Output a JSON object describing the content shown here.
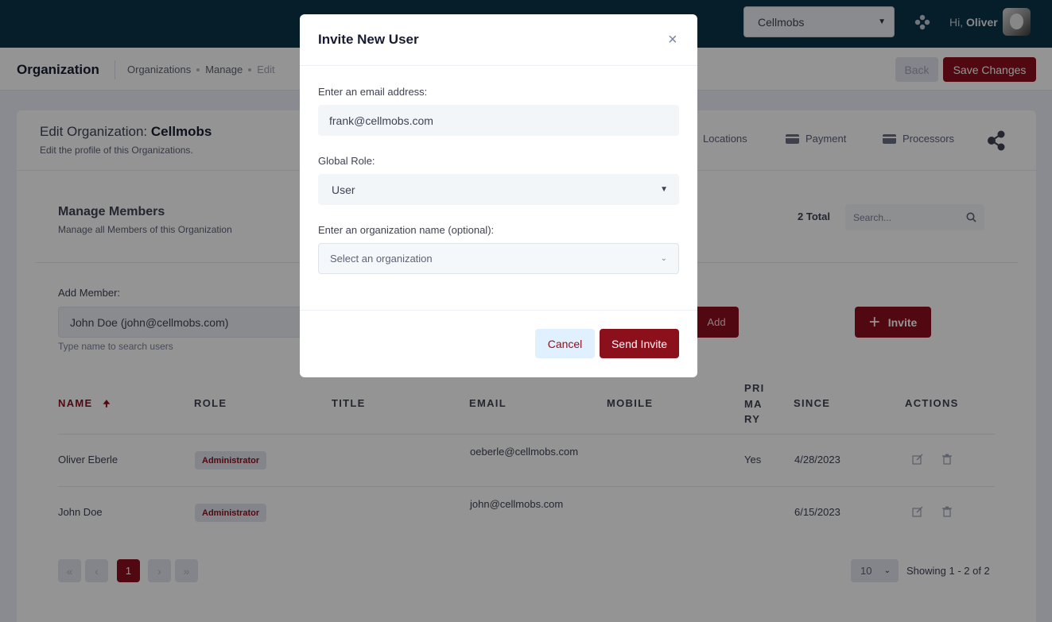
{
  "header": {
    "org_select": "Cellmobs",
    "greeting_prefix": "Hi,",
    "user_name": "Oliver"
  },
  "subheader": {
    "title": "Organization",
    "breadcrumbs": [
      "Organizations",
      "Manage",
      "Edit"
    ],
    "back_label": "Back",
    "save_label": "Save Changes"
  },
  "org_card": {
    "title_prefix": "Edit Organization:",
    "org_name": "Cellmobs",
    "subtitle": "Edit the profile of this Organizations.",
    "tabs": [
      "Locations",
      "Payment",
      "Processors"
    ]
  },
  "members": {
    "title": "Manage Members",
    "subtitle": "Manage all Members of this Organization",
    "total": "2 Total",
    "search_placeholder": "Search...",
    "add_member_label": "Add Member:",
    "add_member_value": "John Doe (john@cellmobs.com)",
    "add_member_hint": "Type name to search users",
    "add_button": "Add",
    "invite_button": "Invite",
    "columns": {
      "name": "NAME",
      "role": "ROLE",
      "title": "TITLE",
      "email": "EMAIL",
      "mobile": "MOBILE",
      "primary": "PRI MA RY",
      "since": "SINCE",
      "actions": "ACTIONS"
    },
    "rows": [
      {
        "name": "Oliver Eberle",
        "role": "Administrator",
        "email": "oeberle@cellmobs.com",
        "primary": "Yes",
        "since": "4/28/2023"
      },
      {
        "name": "John Doe",
        "role": "Administrator",
        "email": "john@cellmobs.com",
        "primary": "",
        "since": "6/15/2023"
      }
    ],
    "pagination": {
      "first": "«",
      "prev": "‹",
      "current_page": "1",
      "next": "›",
      "last": "»",
      "per_page": "10",
      "showing": "Showing 1 - 2 of 2"
    }
  },
  "modal": {
    "title": "Invite New User",
    "close": "×",
    "email_label": "Enter an email address:",
    "email_value": "frank@cellmobs.com",
    "role_label": "Global Role:",
    "role_value": "User",
    "org_label": "Enter an organization name (optional):",
    "org_placeholder": "Select an organization",
    "cancel_label": "Cancel",
    "send_label": "Send Invite"
  },
  "icons": {
    "sort": "arrow-up-icon",
    "edit": "edit-icon",
    "delete": "trash-icon",
    "search": "search-icon",
    "share": "share-icon",
    "apps": "apps-grid-icon",
    "payment": "credit-card-icon",
    "location": "location-icon"
  },
  "colors": {
    "brand": "#8c0f1c",
    "header_bg": "#0b3548",
    "badge_bg": "#e4e6ef"
  }
}
